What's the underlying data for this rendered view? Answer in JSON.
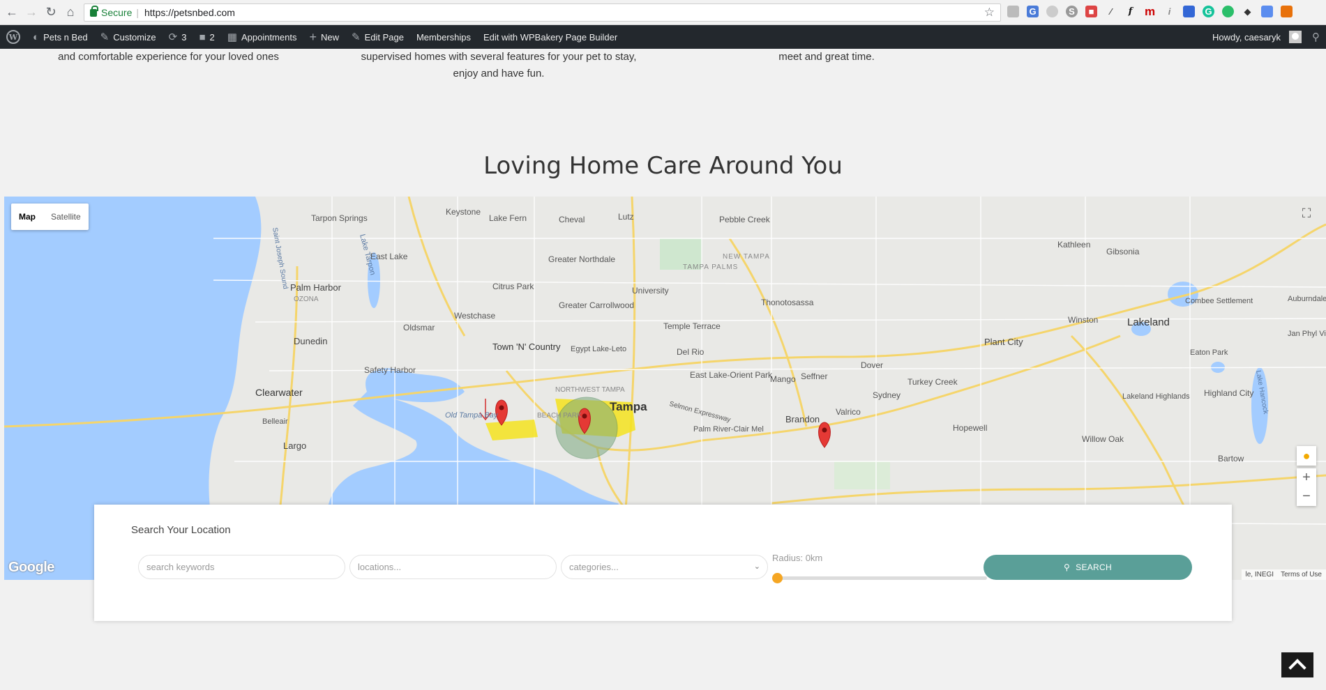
{
  "browser": {
    "secure_label": "Secure",
    "url": "https://petsnbed.com"
  },
  "wp_bar": {
    "site_name": "Pets n Bed",
    "customize": "Customize",
    "updates_count": "3",
    "comments_count": "2",
    "appointments": "Appointments",
    "new": "New",
    "edit_page": "Edit Page",
    "memberships": "Memberships",
    "wpbakery": "Edit with WPBakery Page Builder",
    "howdy": "Howdy, caesaryk"
  },
  "features": {
    "col1_line1": "and comfortable experience for your loved ones",
    "col2_line1": "supervised homes with several features for your pet to stay,",
    "col2_line2": "enjoy and have fun.",
    "col3_line1": "meet and great time."
  },
  "section_title": "Loving Home Care Around You",
  "map": {
    "type_map": "Map",
    "type_satellite": "Satellite",
    "google": "Google",
    "attrib_data": "le, INEGI",
    "attrib_terms": "Terms of Use",
    "labels": [
      {
        "text": "Tarpon Springs"
      },
      {
        "text": "Keystone"
      },
      {
        "text": "Lake Fern"
      },
      {
        "text": "Cheval"
      },
      {
        "text": "Lutz"
      },
      {
        "text": "Pebble Creek"
      },
      {
        "text": "East Lake"
      },
      {
        "text": "Greater Northdale"
      },
      {
        "text": "NEW TAMPA"
      },
      {
        "text": "TAMPA PALMS"
      },
      {
        "text": "Palm Harbor"
      },
      {
        "text": "OZONA"
      },
      {
        "text": "Citrus Park"
      },
      {
        "text": "University"
      },
      {
        "text": "Greater Carrollwood"
      },
      {
        "text": "Westchase"
      },
      {
        "text": "Thonotosassa"
      },
      {
        "text": "Dunedin"
      },
      {
        "text": "Oldsmar"
      },
      {
        "text": "Town 'N' Country"
      },
      {
        "text": "Egypt Lake-Leto"
      },
      {
        "text": "Temple Terrace"
      },
      {
        "text": "Del Rio"
      },
      {
        "text": "Safety Harbor"
      },
      {
        "text": "East Lake-Orient Park"
      },
      {
        "text": "Mango"
      },
      {
        "text": "Seffner"
      },
      {
        "text": "Dover"
      },
      {
        "text": "Plant City"
      },
      {
        "text": "Clearwater"
      },
      {
        "text": "NORTHWEST TAMPA"
      },
      {
        "text": "Tampa"
      },
      {
        "text": "BEACH PARK"
      },
      {
        "text": "Old Tampa Bay"
      },
      {
        "text": "Brandon"
      },
      {
        "text": "Valrico"
      },
      {
        "text": "Sydney"
      },
      {
        "text": "Turkey Creek"
      },
      {
        "text": "Belleair"
      },
      {
        "text": "Largo"
      },
      {
        "text": "Palm River-Clair Mel"
      },
      {
        "text": "Hopewell"
      },
      {
        "text": "Kathleen"
      },
      {
        "text": "Gibsonia"
      },
      {
        "text": "Lakeland"
      },
      {
        "text": "Winston"
      },
      {
        "text": "Combee Settlement"
      },
      {
        "text": "Auburndale"
      },
      {
        "text": "Jan Phyl Village"
      },
      {
        "text": "Eaton Park"
      },
      {
        "text": "Lakeland Highlands"
      },
      {
        "text": "Highland City"
      },
      {
        "text": "Lake Hancock"
      },
      {
        "text": "Willow Oak"
      },
      {
        "text": "Bartow"
      },
      {
        "text": "Selmon Expressway"
      },
      {
        "text": "Lake Tarpon"
      },
      {
        "text": "Saint Joseph Sound"
      }
    ]
  },
  "search": {
    "title": "Search Your Location",
    "keywords_placeholder": "search keywords",
    "locations_placeholder": "locations...",
    "categories_placeholder": "categories...",
    "radius_label": "Radius: 0km",
    "radius_value": 0,
    "button_label": "SEARCH"
  },
  "colors": {
    "accent": "#5a9f98",
    "slider": "#f5a623",
    "wp_bar": "#23282d",
    "water": "#a3ccff"
  }
}
